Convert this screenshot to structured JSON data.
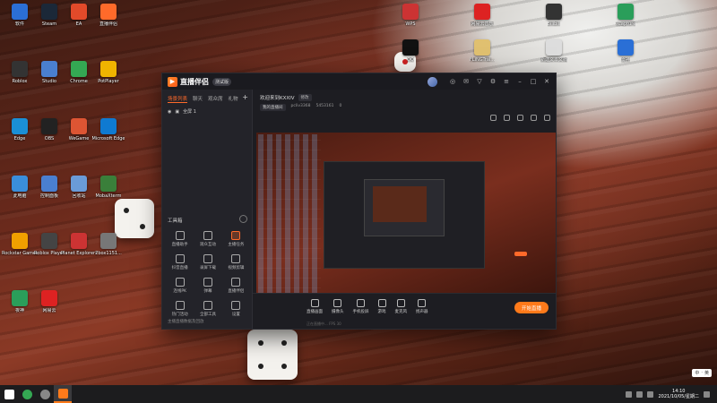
{
  "desktop": {
    "icons_left": [
      {
        "label": "软件",
        "color": "#2b6fd6"
      },
      {
        "label": "Steam",
        "color": "#1b2838"
      },
      {
        "label": "EA",
        "color": "#e24a2a"
      },
      {
        "label": "直播伴侣",
        "color": "#ff6a2a"
      },
      {
        "label": "Roblox",
        "color": "#333"
      },
      {
        "label": "Studio",
        "color": "#4a7fd0"
      },
      {
        "label": "Chrome",
        "color": "#34a853"
      },
      {
        "label": "PotPlayer",
        "color": "#f0b400"
      },
      {
        "label": "Edge",
        "color": "#1a8fd6"
      },
      {
        "label": "OBS",
        "color": "#222"
      },
      {
        "label": "WeGame",
        "color": "#d53"
      },
      {
        "label": "Microsoft Edge",
        "color": "#0f7ad1"
      },
      {
        "label": "此电脑",
        "color": "#3a8edb"
      },
      {
        "label": "控制面板",
        "color": "#4a7fd0"
      },
      {
        "label": "回收站",
        "color": "#6a9bd8"
      },
      {
        "label": "MobaXterm",
        "color": "#3a7f3a"
      },
      {
        "label": "Rockstar Games",
        "color": "#f0a000"
      },
      {
        "label": "Roblox Player",
        "color": "#444"
      },
      {
        "label": "Planet Explorers",
        "color": "#c33"
      },
      {
        "label": "2box1151...",
        "color": "#777"
      },
      {
        "label": "夜神",
        "color": "#2a9e5a"
      },
      {
        "label": "网易云",
        "color": "#d22"
      }
    ],
    "icons_top_right": [
      {
        "label": "WPS",
        "color": "#c33"
      },
      {
        "label": "网易云音乐",
        "color": "#d22"
      },
      {
        "label": "Bilibili",
        "color": "#333"
      },
      {
        "label": "TCapture",
        "color": "#2a9e5a"
      },
      {
        "label": "QQ",
        "color": "#111"
      },
      {
        "label": "FLiNGTrai...",
        "color": "#e0c070"
      },
      {
        "label": "新建文本文档",
        "color": "#ddd"
      },
      {
        "label": "雷神",
        "color": "#2a6fd6"
      }
    ]
  },
  "window": {
    "app_name": "直播伴侣",
    "version": "测试版",
    "side_tabs": [
      "场景列表",
      "聊天",
      "观众席",
      "礼物"
    ],
    "scene_label": "全屏 1",
    "tools_title": "工具箱",
    "tools": [
      {
        "label": "直播助手",
        "hot": false
      },
      {
        "label": "观众互动",
        "hot": false
      },
      {
        "label": "主播任务",
        "hot": true
      },
      {
        "label": "抖音直播",
        "hot": false
      },
      {
        "label": "录屏下载",
        "hot": false
      },
      {
        "label": "视频剪辑",
        "hot": false
      },
      {
        "label": "连线PK",
        "hot": false
      },
      {
        "label": "弹幕",
        "hot": false
      },
      {
        "label": "直播伴侣",
        "hot": false
      },
      {
        "label": "热门活动",
        "hot": false
      },
      {
        "label": "全部工具",
        "hot": false
      },
      {
        "label": "设置",
        "hot": false
      }
    ],
    "side_footer": "主播直播数据及回放",
    "room_title": "欢迎来到KXXIV",
    "edit_label": "修改",
    "meta": [
      "我的直播间",
      "pcliv3368",
      "5453161",
      "0"
    ],
    "controls": [
      {
        "label": "直播画面"
      },
      {
        "label": "摄像头"
      },
      {
        "label": "手机投屏"
      },
      {
        "label": "游戏"
      },
      {
        "label": "麦克风"
      },
      {
        "label": "扬声器"
      }
    ],
    "start_button": "开始直播",
    "status_line": "正在直播中... FPS 30"
  },
  "taskbar": {
    "clock_time": "14:10",
    "clock_date": "2021/10/05/星期二",
    "ime": [
      "中",
      "·",
      "英"
    ]
  }
}
